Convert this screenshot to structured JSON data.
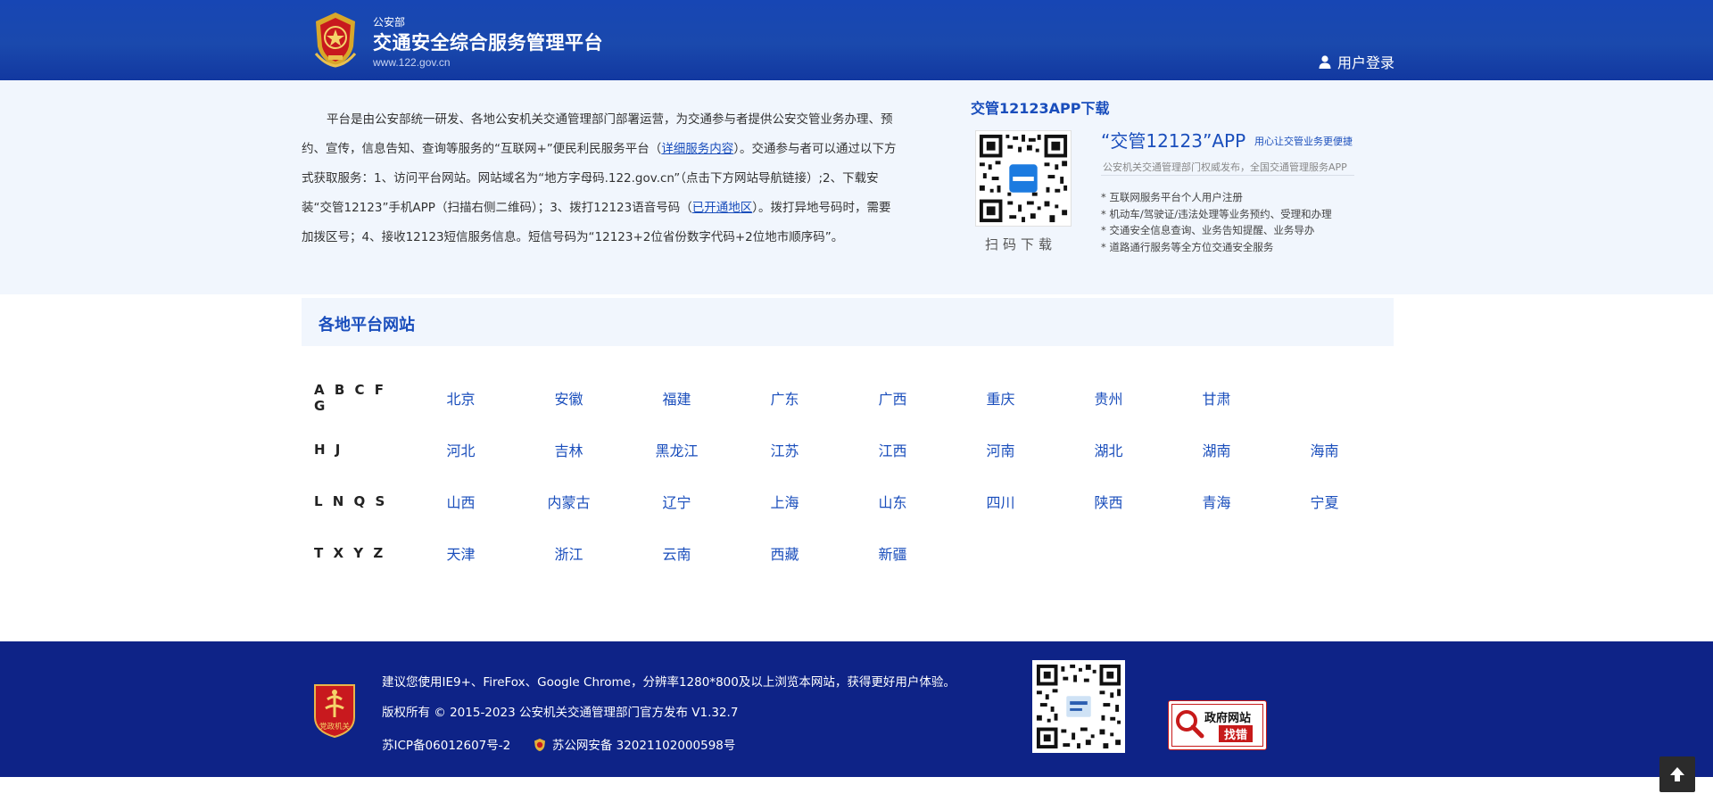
{
  "header": {
    "org_small": "公安部",
    "title": "交通安全综合服务管理平台",
    "url": "www.122.gov.cn",
    "login_label": "用户登录"
  },
  "intro": {
    "text_1": "平台是由公安部统一研发、各地公安机关交通管理部门部署运营，为交通参与者提供公安交管业务办理、预约、宣传，信息告知、查询等服务的“互联网+”便民利民服务平台（",
    "link_details": "详细服务内容",
    "text_2": "）。交通参与者可以通过以下方式获取服务：1、访问平台网站。网站域名为“地方字母码.122.gov.cn”（点击下方网站导航链接）;2、下载安装“交管12123”手机APP（扫描右侧二维码）；3、拨打12123语音号码（",
    "link_regions": "已开通地区",
    "text_3": "）。拨打异地号码时，需要加拨区号；4、接收12123短信服务信息。短信号码为“12123+2位省份数字代码+2位地市顺序码”。"
  },
  "app": {
    "heading": "交管12123APP下载",
    "qr_caption": "扫码下载",
    "name": "“交管12123”APP",
    "slogan": "用心让交管业务更便捷",
    "subtitle": "公安机关交通管理部门权威发布，全国交通管理服务APP",
    "features": [
      "互联网服务平台个人用户注册",
      "机动车/驾驶证/违法处理等业务预约、受理和办理",
      "交通安全信息查询、业务告知提醒、业务导办",
      "道路通行服务等全方位交通安全服务"
    ]
  },
  "platforms": {
    "title": "各地平台网站",
    "groups": [
      {
        "letters": "A B C F G",
        "regions": [
          "北京",
          "安徽",
          "福建",
          "广东",
          "广西",
          "重庆",
          "贵州",
          "甘肃"
        ]
      },
      {
        "letters": "H J",
        "regions": [
          "河北",
          "吉林",
          "黑龙江",
          "江苏",
          "江西",
          "河南",
          "湖北",
          "湖南",
          "海南"
        ]
      },
      {
        "letters": "L N Q S",
        "regions": [
          "山西",
          "内蒙古",
          "辽宁",
          "上海",
          "山东",
          "四川",
          "陕西",
          "青海",
          "宁夏"
        ]
      },
      {
        "letters": "T X Y Z",
        "regions": [
          "天津",
          "浙江",
          "云南",
          "西藏",
          "新疆"
        ]
      }
    ]
  },
  "footer": {
    "badge_text": "党政机关",
    "browser_note": "建议您使用IE9+、FireFox、Google Chrome，分辨率1280*800及以上浏览本网站，获得更好用户体验。",
    "copyright": "版权所有 © 2015-2023 公安机关交通管理部门官方发布 V1.32.7",
    "icp": "苏ICP备06012607号-2",
    "beian": "苏公网安备 32021102000598号",
    "gov_line1": "政府网站",
    "gov_line2": "找错"
  },
  "colors": {
    "header_blue": "#1746b4",
    "link_blue": "#1a4ebc",
    "footer_navy": "#0e2387",
    "intro_bg": "#f1f6fd"
  }
}
